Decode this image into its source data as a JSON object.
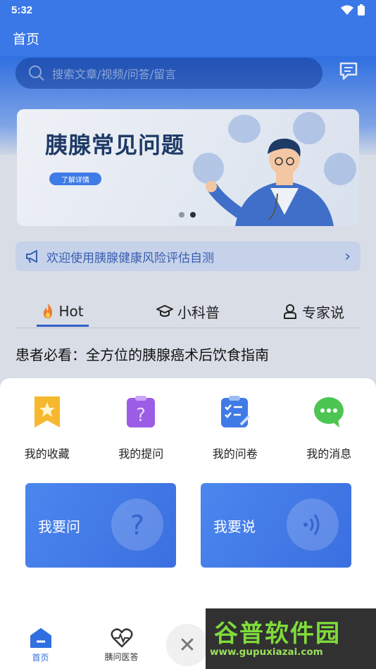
{
  "status_bar": {
    "time": "5:32"
  },
  "app_bar": {
    "title": "首页"
  },
  "search": {
    "placeholder": "搜索文章/视频/问答/留言"
  },
  "banner": {
    "title": "胰腺常见问题",
    "button": "了解详情"
  },
  "notice": {
    "text": "欢迎使用胰腺健康风险评估自测"
  },
  "tabs": [
    {
      "label": "Hot",
      "icon": "fire-icon"
    },
    {
      "label": "小科普",
      "icon": "graduation-cap-icon"
    },
    {
      "label": "专家说",
      "icon": "user-icon"
    }
  ],
  "article": {
    "title": "患者必看：全方位的胰腺癌术后饮食指南"
  },
  "sheet": {
    "items": [
      {
        "label": "我的收藏",
        "icon": "star-bookmark-icon",
        "color": "#f5b82e"
      },
      {
        "label": "我的提问",
        "icon": "question-clipboard-icon",
        "color": "#9b5de5"
      },
      {
        "label": "我的问卷",
        "icon": "checklist-icon",
        "color": "#3f7be6"
      },
      {
        "label": "我的消息",
        "icon": "chat-bubble-icon",
        "color": "#4cc552"
      }
    ],
    "cards": [
      {
        "label": "我要问",
        "icon": "question-icon"
      },
      {
        "label": "我要说",
        "icon": "sound-icon"
      }
    ]
  },
  "bottom_nav": [
    {
      "label": "首页",
      "icon": "home-icon",
      "active": true
    },
    {
      "label": "胰问医答",
      "icon": "heart-pulse-icon",
      "active": false
    }
  ],
  "watermark": {
    "text": "谷普软件园",
    "url": "www.gupuxiazai.com"
  }
}
